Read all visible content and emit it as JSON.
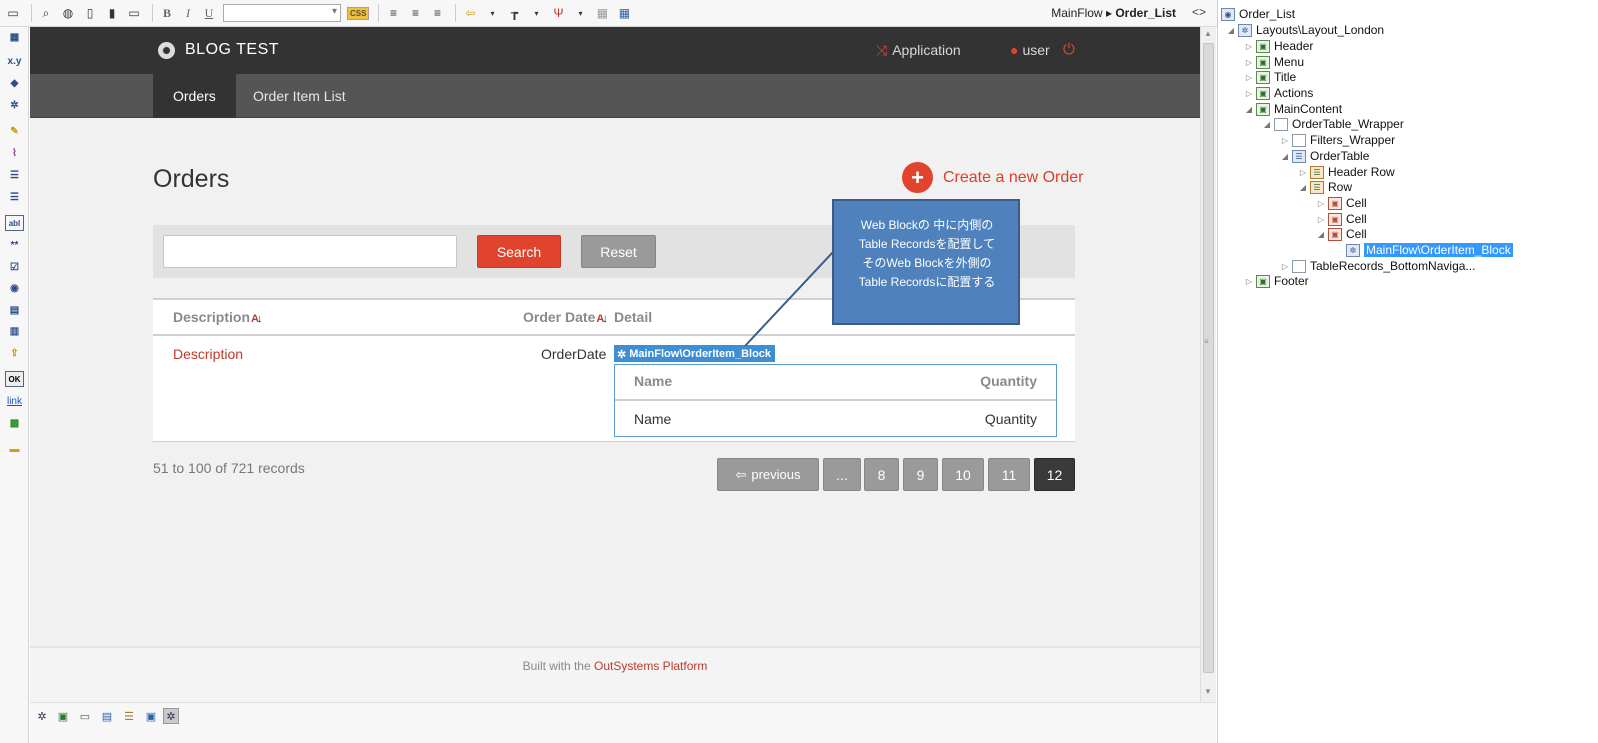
{
  "toolbar": {
    "font_value": "",
    "css_label": "CSS",
    "breadcrumb_flow": "MainFlow",
    "breadcrumb_sep": "▸",
    "breadcrumb_screen": "Order_List",
    "code_toggle": "<>"
  },
  "header": {
    "app_title": "BLOG TEST",
    "application_link": "Application",
    "user_link": "user"
  },
  "menu": {
    "items": [
      {
        "label": "Orders",
        "active": true
      },
      {
        "label": "Order Item List",
        "active": false
      }
    ]
  },
  "page": {
    "title": "Orders",
    "create_label": "Create a new Order",
    "search_placeholder": "",
    "search_label": "Search",
    "reset_label": "Reset"
  },
  "table": {
    "columns": [
      "Description",
      "Order Date",
      "Detail"
    ],
    "row": {
      "description": "Description",
      "order_date": "OrderDate"
    },
    "block_tag": "MainFlow\\OrderItem_Block",
    "inner_columns": [
      "Name",
      "Quantity"
    ],
    "inner_row": {
      "name": "Name",
      "quantity": "Quantity"
    }
  },
  "records": {
    "count_text": "51 to 100 of 721 records",
    "previous_label": "previous",
    "ellipsis": "...",
    "pages": [
      "8",
      "9",
      "10",
      "11",
      "12"
    ],
    "current_page": "12"
  },
  "footer": {
    "text": "Built with the ",
    "link": "OutSystems Platform"
  },
  "callout": {
    "lines": [
      "Web Blockの 中に内側の",
      "Table Recordsを配置して",
      "そのWeb Blockを外側の",
      "Table Recordsに配置する"
    ]
  },
  "tree": {
    "nodes": [
      {
        "label": "Order_List"
      },
      {
        "label": "Layouts\\Layout_London"
      },
      {
        "label": "Header"
      },
      {
        "label": "Menu"
      },
      {
        "label": "Title"
      },
      {
        "label": "Actions"
      },
      {
        "label": "MainContent"
      },
      {
        "label": "OrderTable_Wrapper"
      },
      {
        "label": "Filters_Wrapper"
      },
      {
        "label": "OrderTable"
      },
      {
        "label": "Header Row"
      },
      {
        "label": "Row"
      },
      {
        "label": "Cell"
      },
      {
        "label": "Cell"
      },
      {
        "label": "Cell"
      },
      {
        "label": "MainFlow\\OrderItem_Block"
      },
      {
        "label": "TableRecords_BottomNaviga..."
      },
      {
        "label": "Footer"
      }
    ]
  },
  "palette": {
    "xy_label": "x.y",
    "ok_label": "OK",
    "link_label": "link",
    "abl_label": "abl"
  },
  "colors": {
    "accent": "#e0442c",
    "header_bg": "#333333",
    "menu_bg": "#555555",
    "callout_bg": "#4f81bd",
    "selection": "#3399ff"
  }
}
